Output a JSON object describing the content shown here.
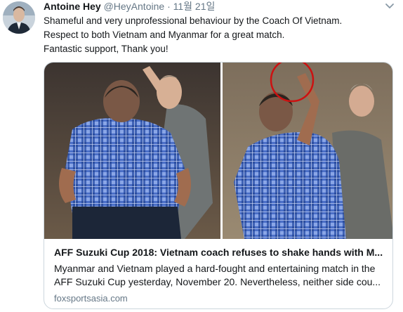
{
  "author": {
    "display_name": "Antoine Hey",
    "handle": "@HeyAntoine",
    "separator": "·",
    "date": "11월 21일"
  },
  "tweet": {
    "lines": [
      "Shameful and very unprofessional  behaviour by the Coach Of Vietnam.",
      "Respect to both Vietnam and Myanmar for a great match.",
      "Fantastic support, Thank you!"
    ]
  },
  "card": {
    "title": "AFF Suzuki Cup 2018: Vietnam coach refuses to shake hands with M...",
    "description_lines": [
      "Myanmar and Vietnam played a hard-fought and entertaining match in the",
      "AFF Suzuki Cup yesterday, November 20. Nevertheless, neither side cou..."
    ],
    "domain": "foxsportsasia.com"
  },
  "icons": {
    "avatar": "profile-photo",
    "caret": "chevron-down-icon"
  },
  "colors": {
    "text_primary": "#14171a",
    "text_secondary": "#657786",
    "card_border": "#ccd6dd",
    "highlight_circle": "#cc1111"
  }
}
